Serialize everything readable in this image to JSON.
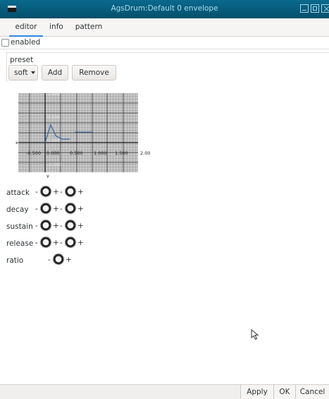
{
  "window": {
    "title": "AgsDrum:Default 0 envelope"
  },
  "tabs": [
    {
      "label": "editor",
      "active": true
    },
    {
      "label": "info",
      "active": false
    },
    {
      "label": "pattern",
      "active": false
    }
  ],
  "enabled": {
    "label": "enabled",
    "checked": false
  },
  "preset": {
    "label": "preset",
    "selected": "soft",
    "add_label": "Add",
    "remove_label": "Remove"
  },
  "envelope_graph": {
    "y_ticks": [
      "1.000",
      "0.500",
      "0.000",
      "-0.500"
    ],
    "x_ticks": [
      "-0.500",
      "0.000",
      "0.500",
      "1.000",
      "1.500",
      "2.00"
    ],
    "x_axis_label": "x",
    "y_axis_label": "y",
    "line_color": "#3465a4",
    "points": [
      [
        0.0,
        0.0
      ],
      [
        0.18,
        0.45
      ],
      [
        0.35,
        0.17
      ],
      [
        0.55,
        0.09
      ],
      [
        0.8,
        0.09
      ]
    ]
  },
  "parameters": [
    {
      "label": "attack",
      "knob_count": 2
    },
    {
      "label": "decay",
      "knob_count": 2
    },
    {
      "label": "sustain",
      "knob_count": 2
    },
    {
      "label": "release",
      "knob_count": 2
    },
    {
      "label": "ratio",
      "knob_count": 1
    }
  ],
  "knob_symbols": {
    "minus": "-",
    "plus": "+"
  },
  "footer": {
    "apply_label": "Apply",
    "ok_label": "OK",
    "cancel_label": "Cancel"
  }
}
